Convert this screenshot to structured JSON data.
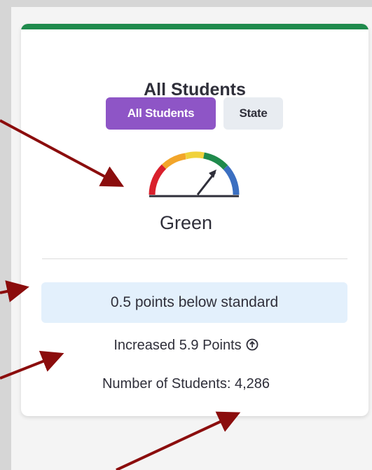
{
  "card": {
    "title": "All Students",
    "tabs": [
      {
        "label": "All Students",
        "active": true
      },
      {
        "label": "State",
        "active": false
      }
    ],
    "gauge": {
      "status": "Green",
      "icon": "speedometer-gauge-icon",
      "segment_colors": [
        "#d9202c",
        "#f2a52a",
        "#f0d23c",
        "#1f8a4c",
        "#3b6fc1"
      ]
    },
    "standard_text": "0.5 points below standard",
    "change_text": "Increased 5.9 Points",
    "change_icon": "arrow-up-circle-icon",
    "student_count_label": "Number of Students:",
    "student_count_value": "4,286"
  },
  "colors": {
    "accent_top_bar": "#1f8a4c",
    "active_tab": "#8e55c6",
    "inactive_tab": "#e8ecf1",
    "standard_box": "#e3f0fc",
    "annotation_arrow": "#8b0d0d"
  }
}
